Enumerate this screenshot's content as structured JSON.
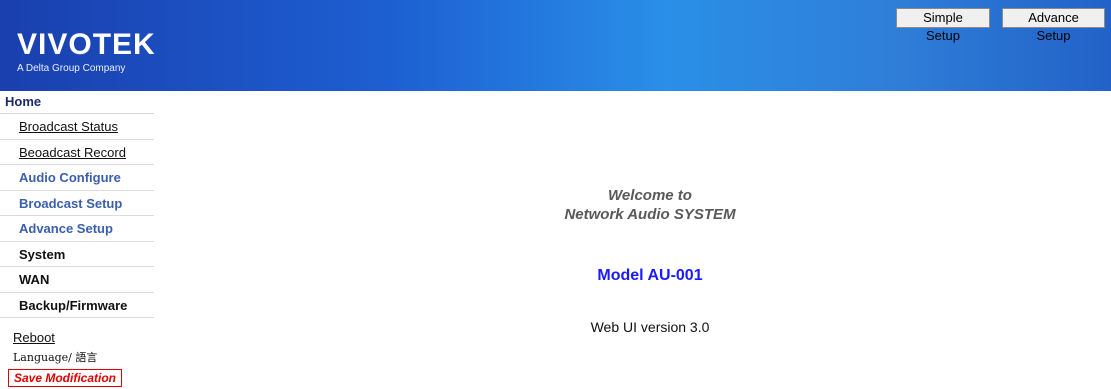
{
  "header": {
    "logo_text": "VIVOTEK",
    "logo_tagline": "A Delta Group Company",
    "simple_setup_label": "Simple Setup",
    "advance_setup_label": "Advance Setup",
    "gradient_colors": [
      "#1a3fae",
      "#2a8fe8",
      "#2262c8"
    ]
  },
  "sidebar": {
    "home_label": "Home",
    "items": [
      {
        "label": "Broadcast Status",
        "style": "link"
      },
      {
        "label": "Beoadcast Record",
        "style": "link"
      },
      {
        "label": "Audio Configure",
        "style": "blue"
      },
      {
        "label": "Broadcast Setup",
        "style": "blue"
      },
      {
        "label": "Advance Setup",
        "style": "blue"
      },
      {
        "label": "System",
        "style": "black"
      },
      {
        "label": "WAN",
        "style": "black"
      },
      {
        "label": "Backup/Firmware",
        "style": "black"
      }
    ],
    "reboot_label": "Reboot",
    "language_label": "Language/ 語言",
    "save_label": "Save Modification"
  },
  "main": {
    "welcome_line1": "Welcome to",
    "welcome_line2": "Network Audio SYSTEM",
    "model": "Model AU-001",
    "version": "Web UI version 3.0"
  },
  "colors": {
    "model_text": "#1a1aff",
    "save_text": "#e00000",
    "nav_blue": "#3a5fae"
  }
}
